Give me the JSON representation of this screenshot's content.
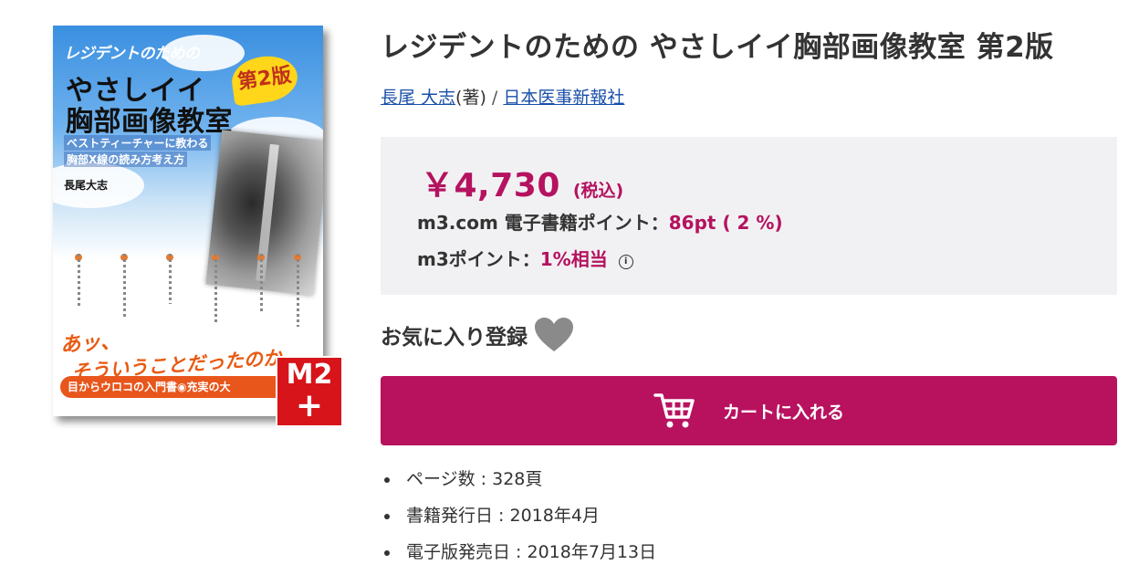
{
  "book": {
    "title": "レジデントのための やさしイイ胸部画像教室 第2版",
    "author": "長尾 大志",
    "author_role": "(著)",
    "separator": "/",
    "publisher": "日本医事新報社"
  },
  "cover": {
    "series": "レジデントのための",
    "title_line1": "やさしイイ",
    "title_line2": "胸部画像教室",
    "edition": "第2版",
    "sub_line1": "ベストティーチャーに教わる",
    "sub_line2": "胸部X線の読み方考え方",
    "author": "長尾大志",
    "catch_line1": "あッ、",
    "catch_line2": "そういうことだったのか",
    "band": "目からウロコの入門書◉充実の大",
    "badge_text": "M2",
    "badge_plus": "+"
  },
  "price": {
    "amount": "￥4,730",
    "tax_note": "(税込)",
    "ebook_point_label": "m3.com 電子書籍ポイント：",
    "ebook_point_value": "86pt ( 2 %)",
    "m3_point_label": "m3ポイント：",
    "m3_point_value": "1%相当",
    "info_icon": "i"
  },
  "favorite": {
    "label": "お気に入り登録",
    "icon": "heart-icon"
  },
  "cart": {
    "label": "カートに入れる",
    "icon": "cart-icon"
  },
  "specs": [
    "ページ数 : 328頁",
    "書籍発行日 : 2018年4月",
    "電子版発売日 : 2018年7月13日"
  ],
  "colors": {
    "accent": "#b8125f",
    "price_box_bg": "#f1f1f3",
    "link": "#1a4fa8",
    "heart": "#8a8a8a"
  }
}
